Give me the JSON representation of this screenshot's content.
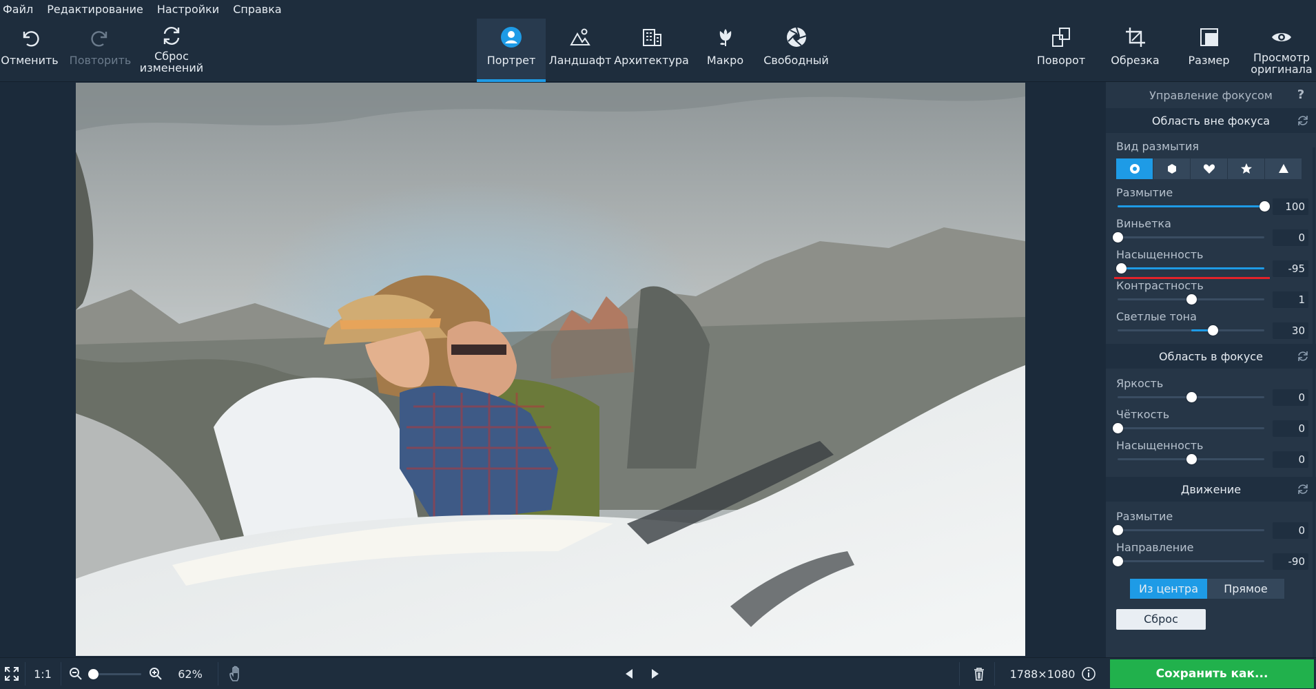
{
  "menu": [
    "Файл",
    "Редактирование",
    "Настройки",
    "Справка"
  ],
  "toolbar": {
    "undo": "Отменить",
    "redo": "Повторить",
    "reset_line1": "Сброс",
    "reset_line2": "изменений",
    "modes": [
      "Портрет",
      "Ландшафт",
      "Архитектура",
      "Макро",
      "Свободный"
    ],
    "active_mode": "Портрет",
    "rotate": "Поворот",
    "crop": "Обрезка",
    "resize": "Размер",
    "preview_line1": "Просмотр",
    "preview_line2": "оригинала"
  },
  "colors": {
    "accent": "#1e9be6",
    "save": "#21b14c",
    "highlight_line": "#e2222a"
  },
  "panel": {
    "title": "Управление фокусом",
    "help": "?",
    "out_of_focus": {
      "title": "Область вне фокуса",
      "blur_type_label": "Вид размытия",
      "blur_types": [
        "circle",
        "hexagon",
        "heart",
        "star",
        "triangle"
      ],
      "active_blur_type": "circle",
      "sliders": [
        {
          "label": "Размытие",
          "value": "100",
          "level": 1.0
        },
        {
          "label": "Виньетка",
          "value": "0",
          "level": 0.0
        },
        {
          "label": "Насыщенность",
          "value": "-95",
          "level": 0.025
        },
        {
          "label": "Контрастность",
          "value": "1",
          "level": 0.5
        },
        {
          "label": "Светлые тона",
          "value": "30",
          "level": 0.65
        }
      ]
    },
    "in_focus": {
      "title": "Область в фокусе",
      "sliders": [
        {
          "label": "Яркость",
          "value": "0",
          "level": 0.5
        },
        {
          "label": "Чёткость",
          "value": "0",
          "level": 0.0
        },
        {
          "label": "Насыщенность",
          "value": "0",
          "level": 0.5
        }
      ]
    },
    "motion": {
      "title": "Движение",
      "sliders": [
        {
          "label": "Размытие",
          "value": "0",
          "level": 0.0
        },
        {
          "label": "Направление",
          "value": "-90",
          "level": 0.0
        }
      ],
      "mode_from_center": "Из центра",
      "mode_straight": "Прямое",
      "reset": "Сброс"
    }
  },
  "status": {
    "one_to_one": "1:1",
    "zoom": "62%",
    "zoom_level": 0.0,
    "dimensions": "1788×1080",
    "save": "Сохранить как..."
  }
}
